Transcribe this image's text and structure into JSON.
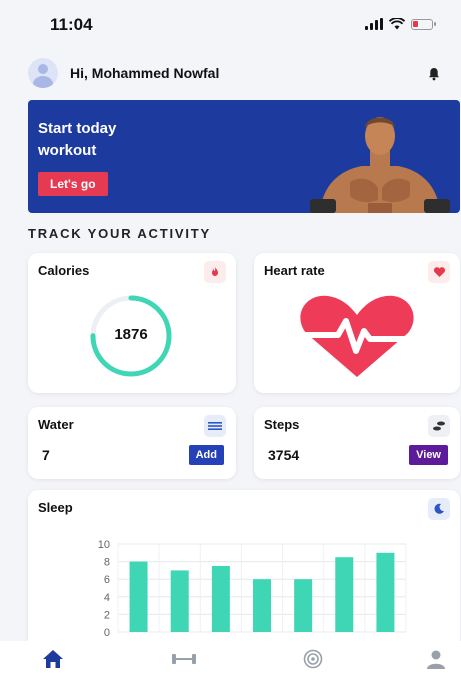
{
  "status_bar": {
    "time": "11:04"
  },
  "header": {
    "greeting": "Hi, Mohammed Nowfal"
  },
  "banner": {
    "title": "Start today workout",
    "button_label": "Let's go"
  },
  "section_title": "TRACK YOUR ACTIVITY",
  "cards": {
    "calories": {
      "title": "Calories",
      "value": "1876",
      "ring_fraction": 0.75
    },
    "heart_rate": {
      "title": "Heart rate"
    },
    "water": {
      "title": "Water",
      "value": "7",
      "button_label": "Add"
    },
    "steps": {
      "title": "Steps",
      "value": "3754",
      "button_label": "View"
    },
    "sleep": {
      "title": "Sleep"
    }
  },
  "colors": {
    "accent": "#3fd6b6",
    "primary": "#1d3a9e",
    "danger": "#e63a53",
    "purple": "#5d1b9a"
  },
  "nav": {
    "items": [
      "home-icon",
      "dumbbell-icon",
      "target-icon",
      "profile-icon"
    ]
  },
  "chart_data": {
    "type": "bar",
    "title": "Sleep",
    "categories": [
      "",
      "",
      "",
      "",
      "",
      "",
      ""
    ],
    "values": [
      8,
      7,
      7.5,
      6,
      6,
      8.5,
      9
    ],
    "yticks": [
      0,
      2,
      4,
      6,
      8,
      10
    ],
    "ylim": [
      0,
      10
    ],
    "grid": true,
    "color": "#3fd6b6"
  }
}
